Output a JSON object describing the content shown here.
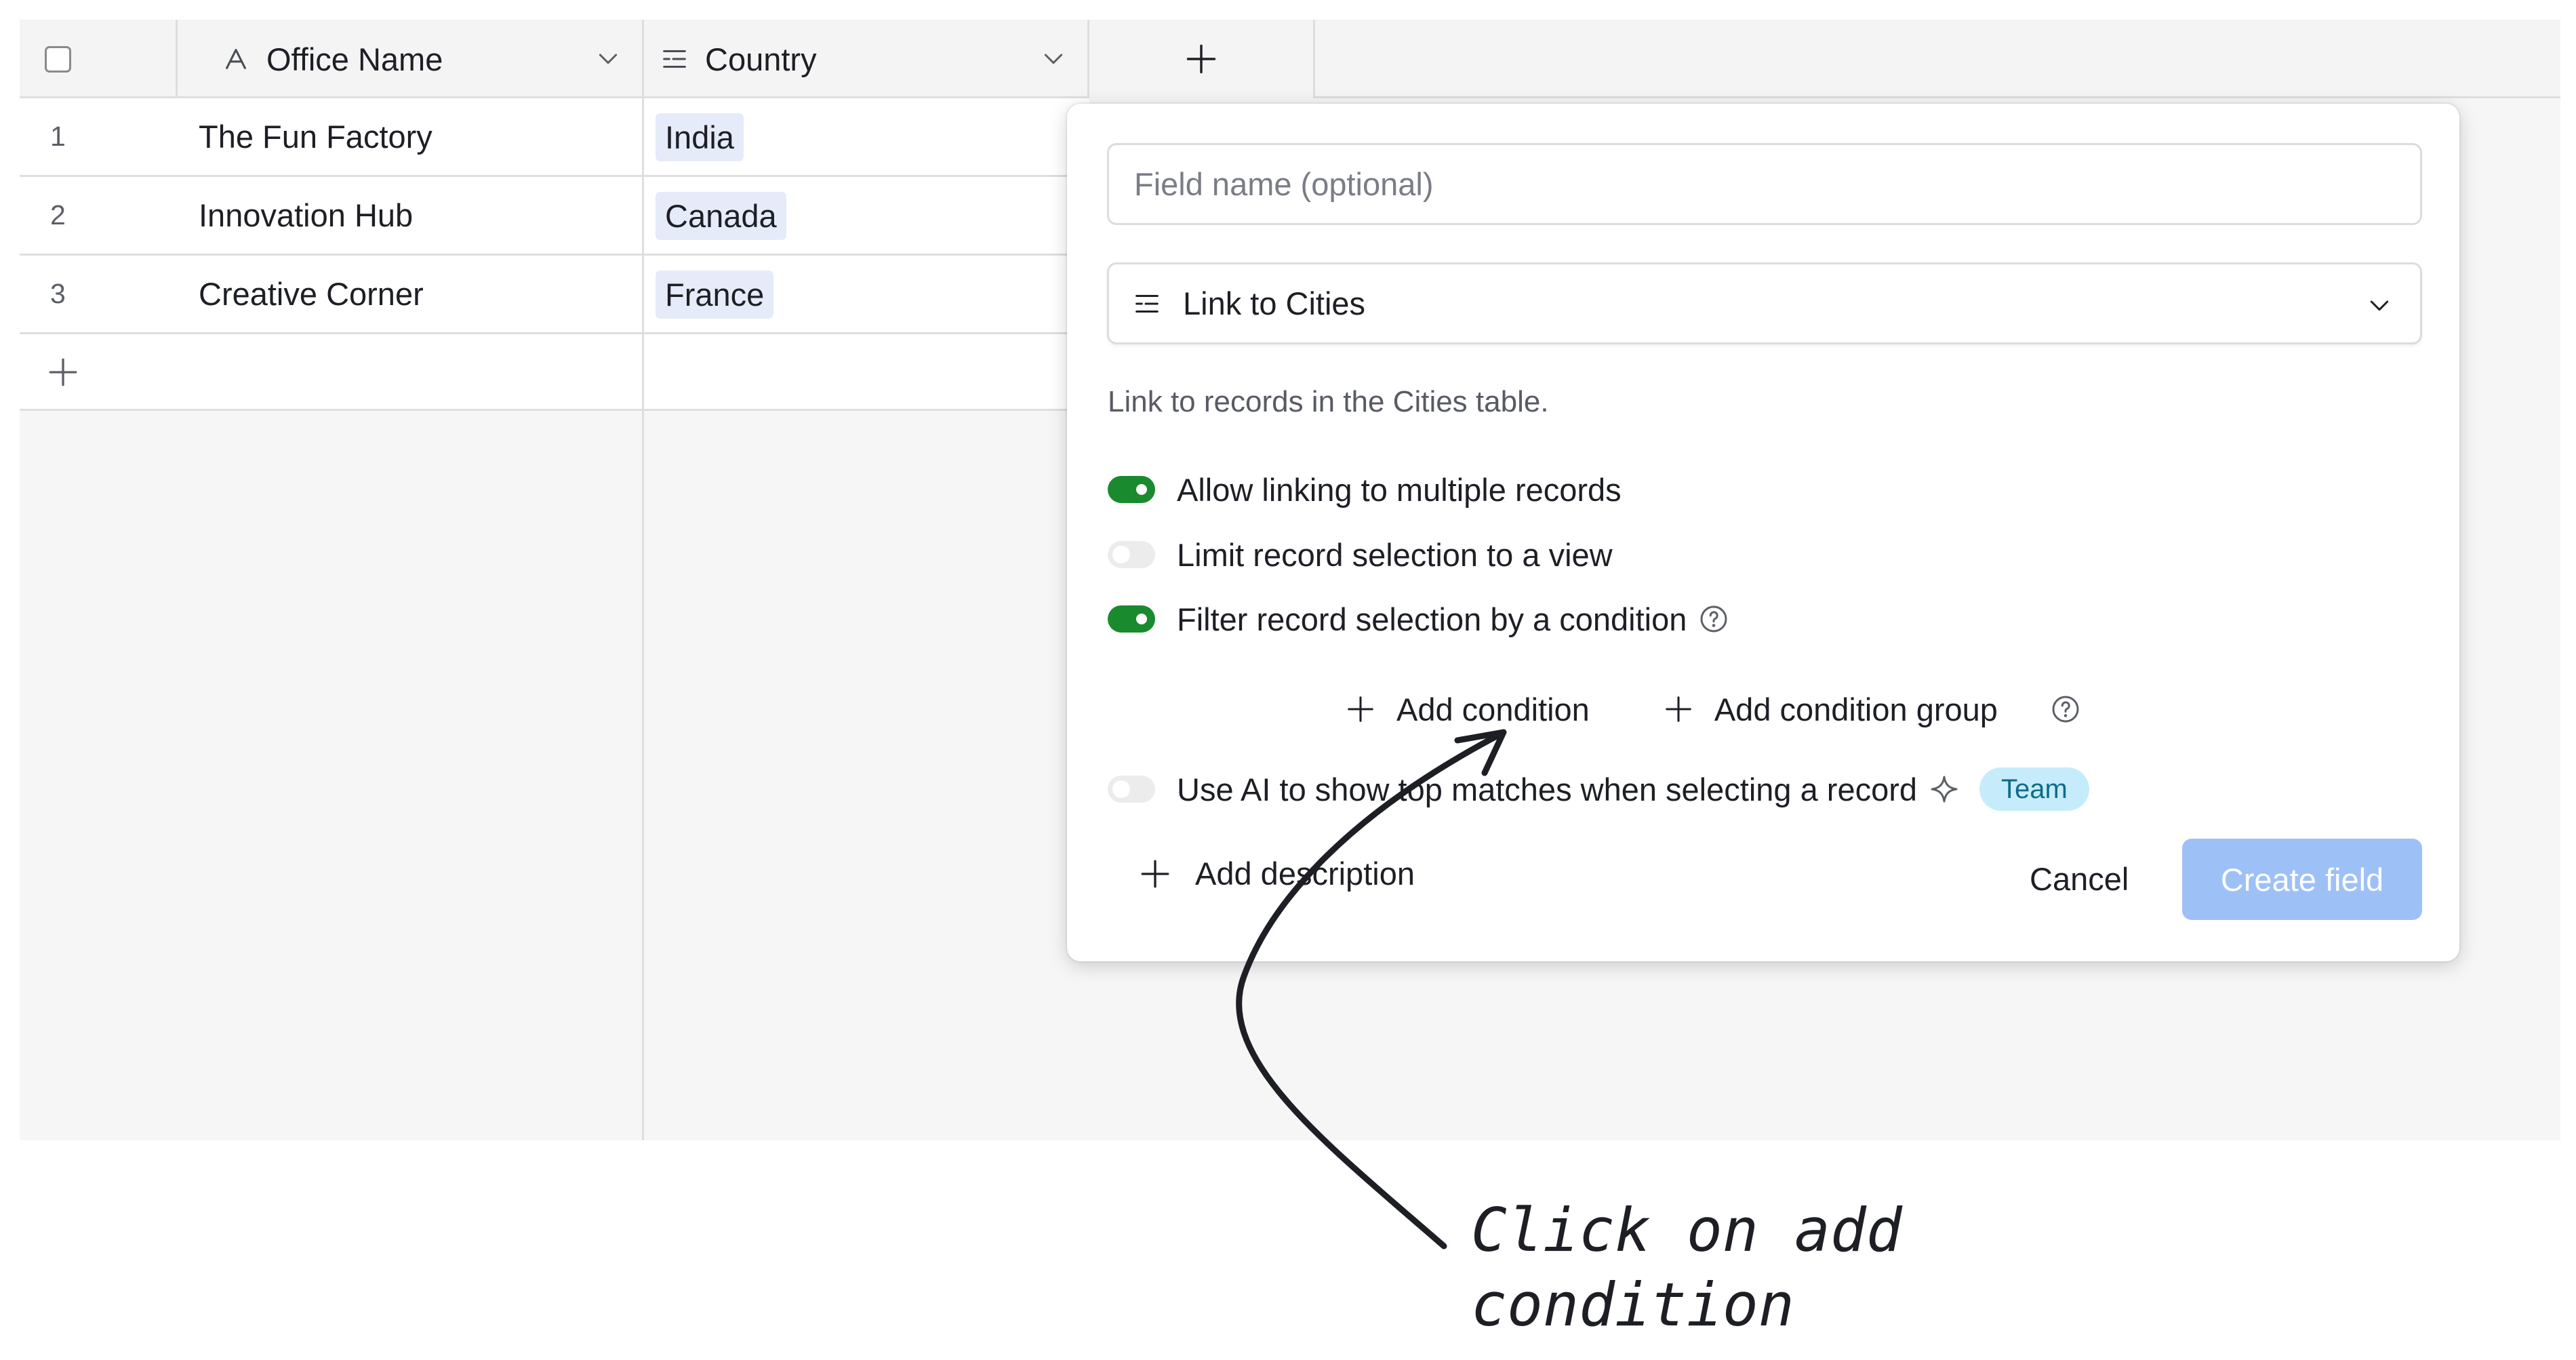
{
  "table": {
    "columns": [
      {
        "label": "Office Name"
      },
      {
        "label": "Country"
      }
    ],
    "rows": [
      {
        "num": "1",
        "name": "The Fun Factory",
        "country": "India"
      },
      {
        "num": "2",
        "name": "Innovation Hub",
        "country": "Canada"
      },
      {
        "num": "3",
        "name": "Creative Corner",
        "country": "France"
      }
    ]
  },
  "dialog": {
    "field_name_placeholder": "Field name (optional)",
    "field_type": "Link to Cities",
    "description": "Link to records in the Cities table.",
    "options": {
      "allow_multiple": {
        "label": "Allow linking to multiple records",
        "on": true
      },
      "limit_view": {
        "label": "Limit record selection to a view",
        "on": false
      },
      "filter_condition": {
        "label": "Filter record selection by a condition",
        "on": true
      },
      "use_ai": {
        "label": "Use AI to show top matches when selecting a record",
        "on": false,
        "badge": "Team"
      }
    },
    "add_condition": "Add condition",
    "add_condition_group": "Add condition group",
    "add_description": "Add description",
    "cancel": "Cancel",
    "create": "Create field"
  },
  "annotation": {
    "line1": "Click on add",
    "line2": "condition"
  },
  "colors": {
    "toggle_on": "#1a8a2f",
    "create_button": "#9dc1f7",
    "team_badge": "#c6ecfb",
    "country_tag": "#e5ebf9"
  }
}
